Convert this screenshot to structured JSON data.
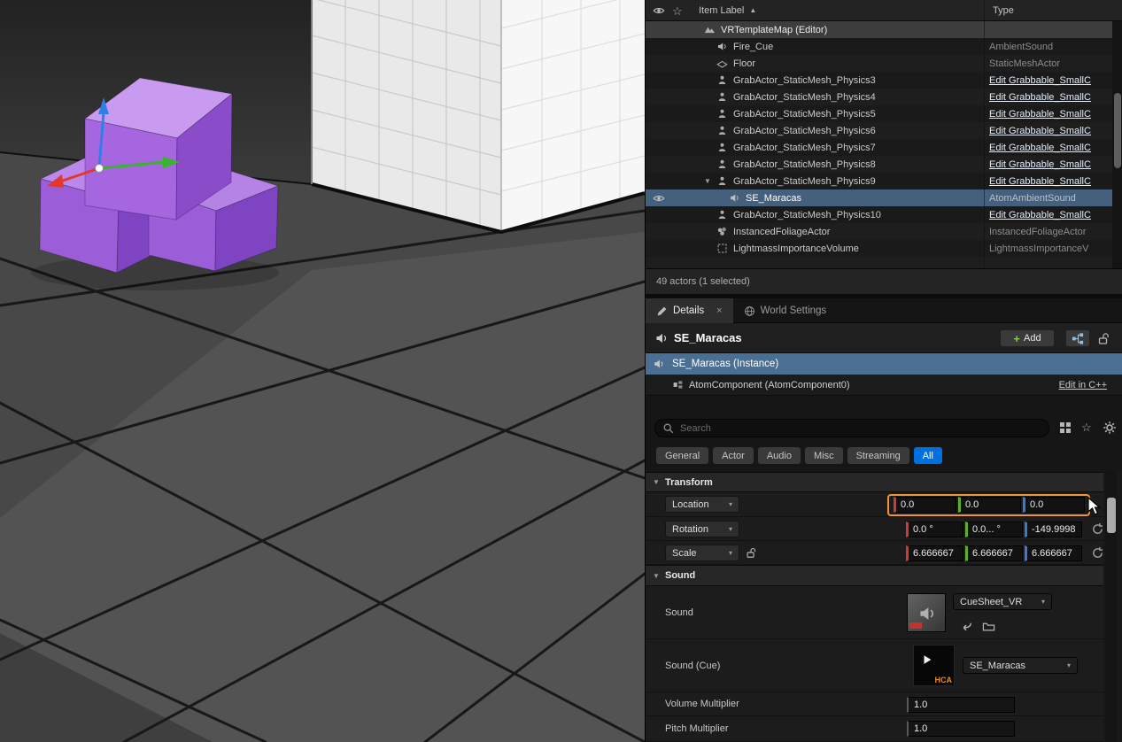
{
  "colors": {
    "accent_blue": "#0070e0",
    "selection_blue": "#44607c",
    "instance_row_blue": "#4b6f92",
    "highlight_orange": "#f09537",
    "cube_purple": "#9c5ed8"
  },
  "icons": {
    "sort_asc": "▲",
    "chevron_down": "▾",
    "section_collapse": "▼",
    "close": "×",
    "plus": "+",
    "star_hollow": "☆"
  },
  "outliner": {
    "header": {
      "item_label": "Item Label",
      "type_label": "Type"
    },
    "rows": [
      {
        "label": "VRTemplateMap (Editor)",
        "type": ""
      },
      {
        "label": "Fire_Cue",
        "type": "AmbientSound"
      },
      {
        "label": "Floor",
        "type": "StaticMeshActor"
      },
      {
        "label": "GrabActor_StaticMesh_Physics3",
        "type": "Edit Grabbable_SmallC"
      },
      {
        "label": "GrabActor_StaticMesh_Physics4",
        "type": "Edit Grabbable_SmallC"
      },
      {
        "label": "GrabActor_StaticMesh_Physics5",
        "type": "Edit Grabbable_SmallC"
      },
      {
        "label": "GrabActor_StaticMesh_Physics6",
        "type": "Edit Grabbable_SmallC"
      },
      {
        "label": "GrabActor_StaticMesh_Physics7",
        "type": "Edit Grabbable_SmallC"
      },
      {
        "label": "GrabActor_StaticMesh_Physics8",
        "type": "Edit Grabbable_SmallC"
      },
      {
        "label": "GrabActor_StaticMesh_Physics9",
        "type": "Edit Grabbable_SmallC"
      },
      {
        "label": "SE_Maracas",
        "type": "AtomAmbientSound"
      },
      {
        "label": "GrabActor_StaticMesh_Physics10",
        "type": "Edit Grabbable_SmallC"
      },
      {
        "label": "InstancedFoliageActor",
        "type": "InstancedFoliageActor"
      },
      {
        "label": "LightmassImportanceVolume",
        "type": "LightmassImportanceV"
      }
    ],
    "status": "49 actors (1 selected)"
  },
  "details": {
    "tabs": {
      "details": "Details",
      "world_settings": "World Settings"
    },
    "header": {
      "title": "SE_Maracas",
      "add": "Add"
    },
    "instance": "SE_Maracas (Instance)",
    "component": {
      "label": "AtomComponent (AtomComponent0)",
      "edit_cpp": "Edit in C++"
    },
    "search": {
      "placeholder": "Search"
    },
    "filters": {
      "general": "General",
      "actor": "Actor",
      "audio": "Audio",
      "misc": "Misc",
      "streaming": "Streaming",
      "all": "All"
    },
    "transform": {
      "title": "Transform",
      "location": {
        "label": "Location",
        "x": "0.0",
        "y": "0.0",
        "z": "0.0"
      },
      "rotation": {
        "label": "Rotation",
        "x": "0.0 °",
        "y": "0.0... °",
        "z": "-149.9998"
      },
      "scale": {
        "label": "Scale",
        "x": "6.666667",
        "y": "6.666667",
        "z": "6.666667"
      }
    },
    "sound": {
      "title": "Sound",
      "sound": {
        "label": "Sound",
        "value": "CueSheet_VR"
      },
      "cue": {
        "label": "Sound (Cue)",
        "value": "SE_Maracas",
        "format": "HCA"
      },
      "volume": {
        "label": "Volume Multiplier",
        "value": "1.0"
      },
      "pitch": {
        "label": "Pitch Multiplier",
        "value": "1.0"
      }
    }
  }
}
